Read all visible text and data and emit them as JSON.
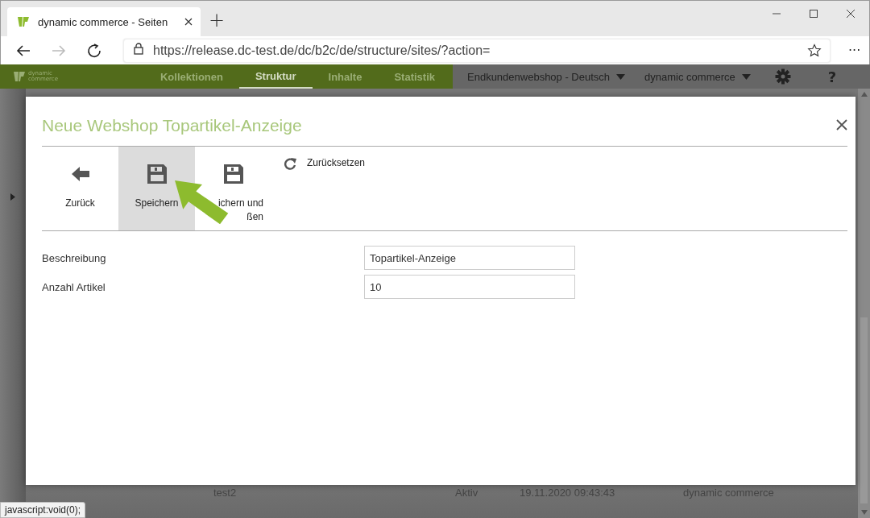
{
  "browser": {
    "tab_title": "dynamic commerce - Seiten",
    "new_tab": "+",
    "url": "https://release.dc-test.de/dc/b2c/de/structure/sites/?action=",
    "more": "···"
  },
  "app_nav": {
    "logo_text": "dynamic commerce",
    "items": [
      {
        "label": "Kollektionen",
        "selected": false
      },
      {
        "label": "Struktur",
        "selected": true
      },
      {
        "label": "Inhalte",
        "selected": false
      },
      {
        "label": "Statistik",
        "selected": false
      }
    ],
    "dropdowns": [
      "Endkundenwebshop - Deutsch",
      "dynamic commerce"
    ],
    "help": "?"
  },
  "background_row": [
    "test2",
    "Aktiv",
    "19.11.2020 09:43:43",
    "dynamic commerce"
  ],
  "dialog": {
    "title": "Neue Webshop Topartikel-Anzeige",
    "toolbar": [
      {
        "kind": "back",
        "label": "Zurück",
        "selected": false
      },
      {
        "kind": "save",
        "label": "Speichern",
        "selected": true
      },
      {
        "kind": "save",
        "label": "ichern und\nßen",
        "selected": false
      },
      {
        "kind": "reset",
        "label": "Zurücksetzen",
        "selected": false
      }
    ],
    "fields": [
      {
        "label": "Beschreibung",
        "value": "Topartikel-Anzeige"
      },
      {
        "label": "Anzahl Artikel",
        "value": "10"
      }
    ]
  },
  "status_text": "javascript:void(0);"
}
